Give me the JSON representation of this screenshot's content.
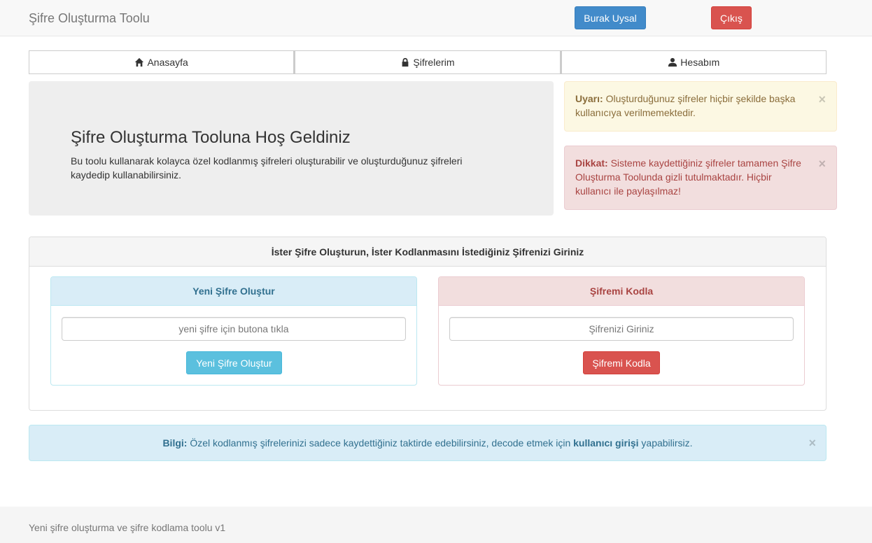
{
  "navbar": {
    "brand": "Şifre Oluşturma Toolu",
    "user_button": "Burak Uysal",
    "logout_button": "Çıkış"
  },
  "tabs": [
    {
      "label": "Anasayfa",
      "icon": "home-icon"
    },
    {
      "label": "Şifrelerim",
      "icon": "lock-icon"
    },
    {
      "label": "Hesabım",
      "icon": "user-icon"
    }
  ],
  "jumbotron": {
    "title": "Şifre Oluşturma Tooluna Hoş Geldiniz",
    "text": "Bu toolu kullanarak kolayca özel kodlanmış şifreleri oluşturabilir ve oluşturduğunuz şifreleri kaydedip kullanabilirsiniz."
  },
  "alerts": {
    "warning": {
      "label": "Uyarı:",
      "text": " Oluşturduğunuz şifreler hiçbir şekilde başka kullanıcıya verilmemektedir."
    },
    "danger": {
      "label": "Dikkat:",
      "text": " Sisteme kaydettiğiniz şifreler tamamen Şifre Oluşturma Toolunda gizli tutulmaktadır. Hiçbir kullanıcı ile paylaşılmaz!"
    },
    "info": {
      "label": "Bilgi:",
      "text_before": " Özel kodlanmış şifrelerinizi sadece kaydettiğiniz taktirde edebilirsiniz, decode etmek için ",
      "link": "kullanıcı girişi",
      "text_after": " yapabilirsiz."
    },
    "close_symbol": "×"
  },
  "main_panel": {
    "heading": "İster Şifre Oluşturun, İster Kodlanmasını İstediğiniz Şifrenizi Giriniz",
    "generate": {
      "heading": "Yeni Şifre Oluştur",
      "placeholder": "yeni şifre için butona tıkla",
      "button": "Yeni Şifre Oluştur"
    },
    "encode": {
      "heading": "Şifremi Kodla",
      "placeholder": "Şifrenizi Giriniz",
      "button": "Şifremi Kodla"
    }
  },
  "footer": {
    "text": "Yeni şifre oluşturma ve şifre kodlama toolu v1"
  },
  "colors": {
    "primary": "#428bca",
    "danger": "#d9534f",
    "info": "#5bc0de"
  }
}
